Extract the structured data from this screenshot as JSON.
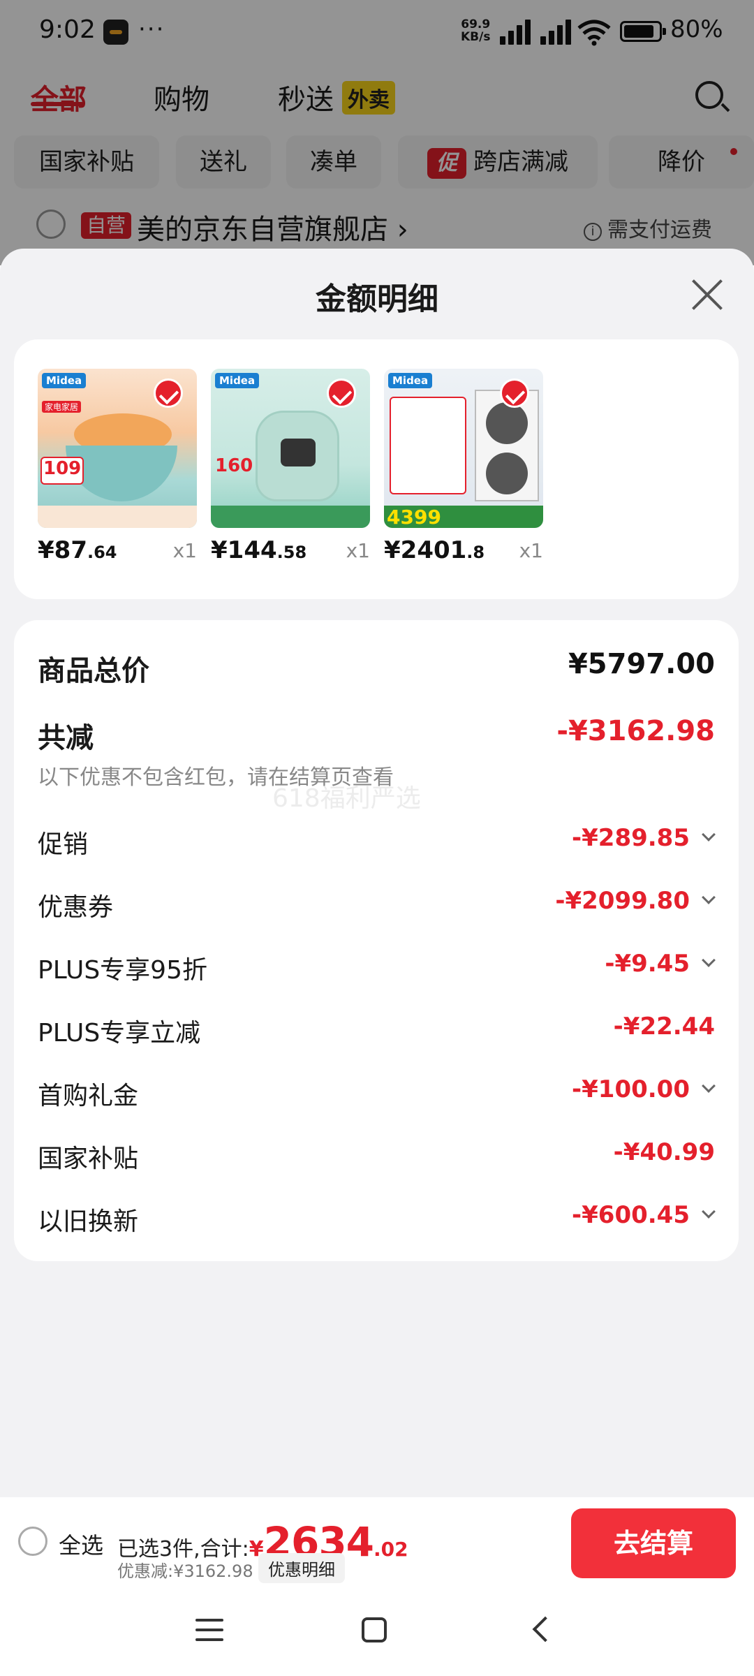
{
  "status": {
    "time": "9:02",
    "more": "···",
    "net_speed": "69.9",
    "net_unit": "KB/s",
    "battery": "80%"
  },
  "top_tabs": [
    {
      "label": "全部"
    },
    {
      "label": "购物"
    },
    {
      "label": "秒送"
    }
  ],
  "waimai_badge": "外卖",
  "chips": [
    {
      "label": "国家补贴"
    },
    {
      "label": "送礼"
    },
    {
      "label": "凑单"
    },
    {
      "label": "跨店满减",
      "promo": "促"
    },
    {
      "label": "降价"
    }
  ],
  "store": {
    "badge": "自营",
    "name": "美的京东自营旗舰店 ›",
    "ship_note": "需支付运费",
    "info_glyph": "i"
  },
  "sheet": {
    "title": "金额明细",
    "products": [
      {
        "brand": "Midea",
        "price_int": "¥87",
        "price_dec": ".64",
        "qty": "x1",
        "art_text": "109"
      },
      {
        "brand": "Midea",
        "price_int": "¥144",
        "price_dec": ".58",
        "qty": "x1",
        "art_text": "160"
      },
      {
        "brand": "Midea",
        "price_int": "¥2401",
        "price_dec": ".8",
        "qty": "x1",
        "art_text": "4399"
      }
    ],
    "total_label": "商品总价",
    "total_value": "¥5797.00",
    "reduce_label": "共减",
    "reduce_value": "-¥3162.98",
    "reduce_note": "以下优惠不包含红包，请在结算页查看",
    "watermark": "618福利严选",
    "discounts": [
      {
        "label": "促销",
        "value": "-¥289.85"
      },
      {
        "label": "优惠券",
        "value": "-¥2099.80"
      },
      {
        "label": "PLUS专享95折",
        "value": "-¥9.45"
      },
      {
        "label": "PLUS专享立减",
        "value": "-¥22.44"
      },
      {
        "label": "首购礼金",
        "value": "-¥100.00"
      },
      {
        "label": "国家补贴",
        "value": "-¥40.99"
      },
      {
        "label": "以旧换新",
        "value": "-¥600.45"
      }
    ]
  },
  "bottom": {
    "select_all": "全选",
    "summary_prefix": "已选3件,合计:",
    "currency": "¥",
    "amount_int": "2634",
    "amount_dec": ".02",
    "discount_line": "优惠减:¥3162.98",
    "detail_btn": "优惠明细",
    "checkout": "去结算"
  },
  "colors": {
    "accent": "#e4202c",
    "checkout": "#f2303a",
    "sheet_bg": "#f2f2f4"
  },
  "icons": [
    "close-icon",
    "search-icon",
    "checkmark-icon",
    "chevron-down-icon",
    "menu-icon",
    "home-icon",
    "back-icon"
  ]
}
